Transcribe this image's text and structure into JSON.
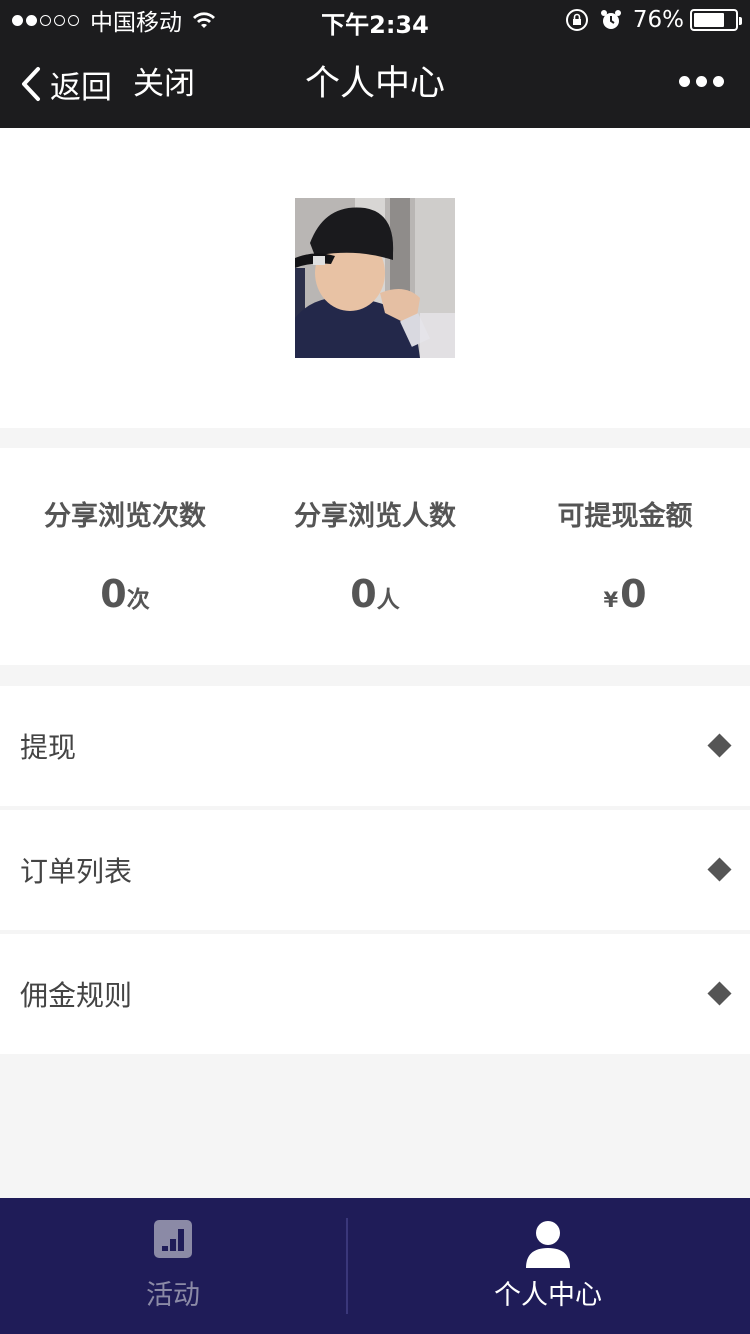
{
  "status_bar": {
    "carrier": "中国移动",
    "time": "下午2:34",
    "battery_percent": "76%",
    "battery_level": 0.76,
    "signal_bars_filled": 2,
    "signal_bars_total": 5
  },
  "nav": {
    "back_label": "返回",
    "close_label": "关闭",
    "title": "个人中心"
  },
  "stats": [
    {
      "label": "分享浏览次数",
      "value": "0",
      "unit": "次",
      "prefix": ""
    },
    {
      "label": "分享浏览人数",
      "value": "0",
      "unit": "人",
      "prefix": ""
    },
    {
      "label": "可提现金额",
      "value": "0",
      "unit": "",
      "prefix": "¥"
    }
  ],
  "menu": [
    {
      "label": "提现"
    },
    {
      "label": "订单列表"
    },
    {
      "label": "佣金规则"
    }
  ],
  "tabbar": {
    "activity_label": "活动",
    "profile_label": "个人中心",
    "active_tab": "profile"
  },
  "colors": {
    "topbar_bg": "#1c1c1e",
    "tabbar_bg": "#1f1c58",
    "page_bg": "#f5f5f5"
  }
}
